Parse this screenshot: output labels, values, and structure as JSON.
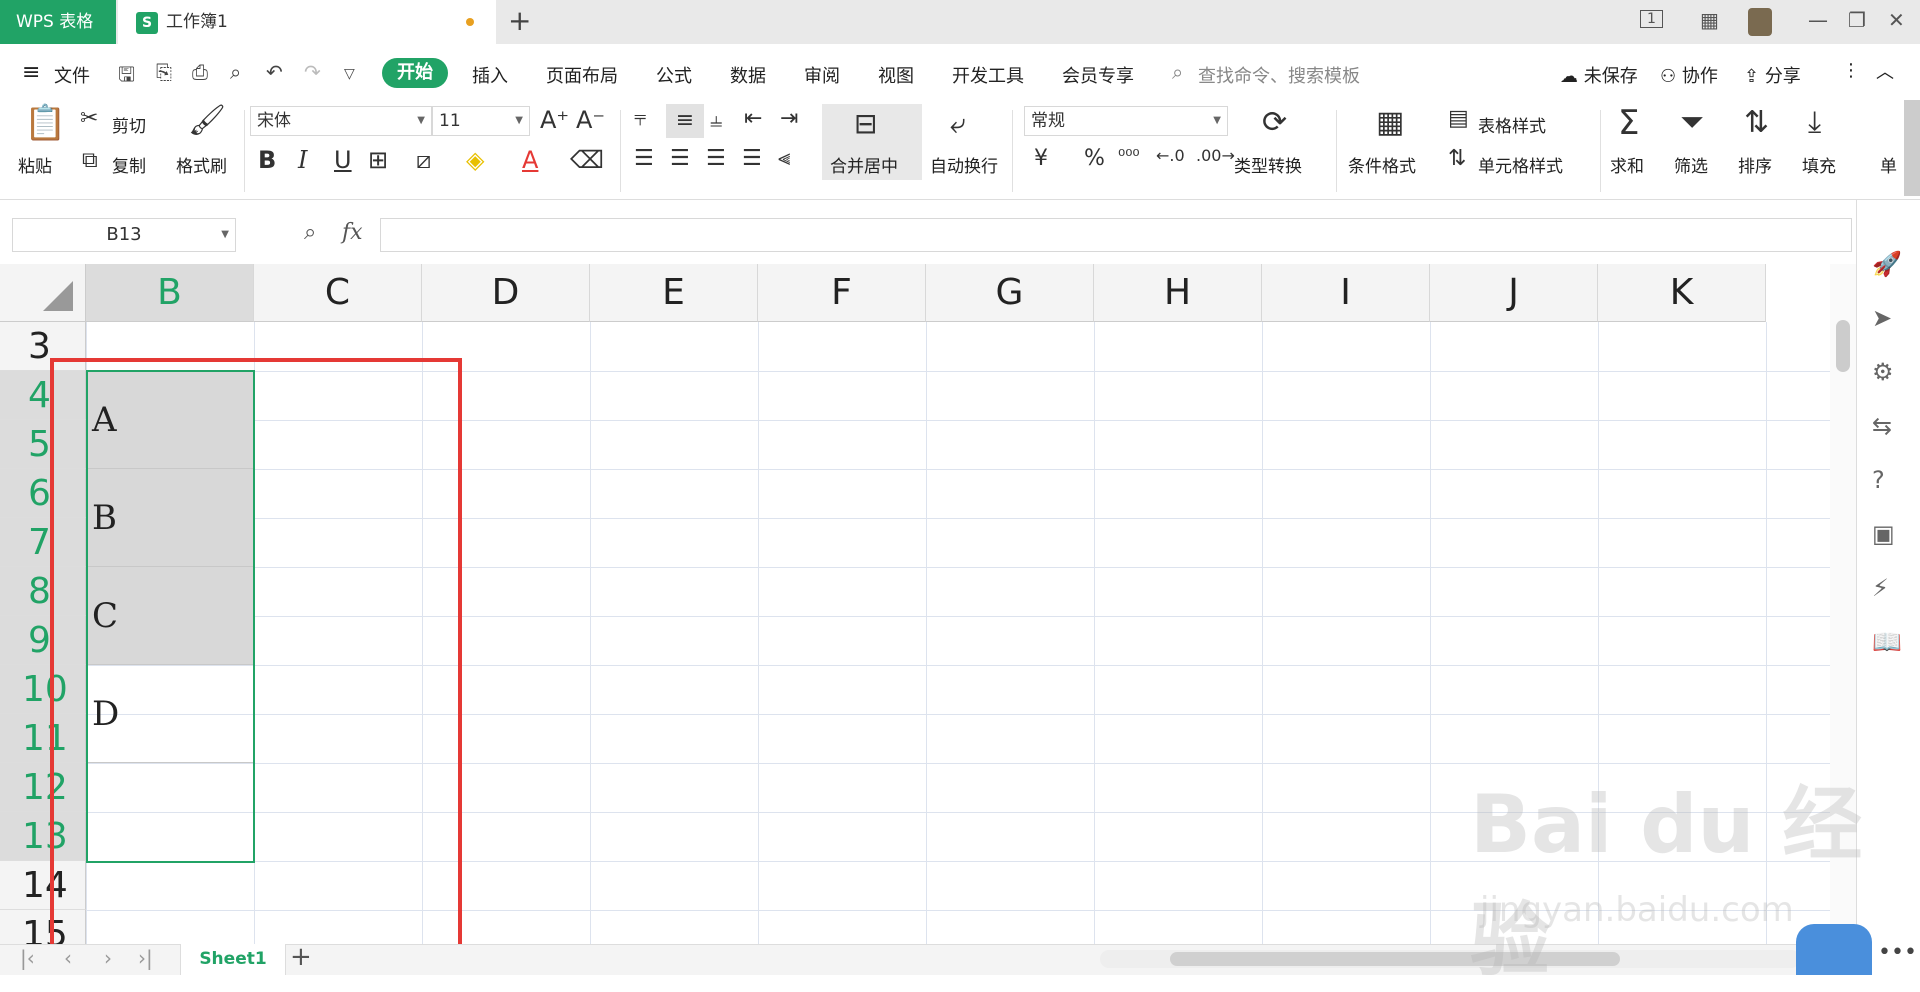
{
  "title_bar": {
    "app_tab": "WPS 表格",
    "doc_tab": "工作簿1",
    "doc_tab_icon": "S",
    "new_tab": "+",
    "controls": [
      "1",
      "▦",
      "—",
      "❐",
      "✕"
    ]
  },
  "menu": {
    "file": "文件",
    "items": [
      "开始",
      "插入",
      "页面布局",
      "公式",
      "数据",
      "审阅",
      "视图",
      "开发工具",
      "会员专享"
    ],
    "search_placeholder": "查找命令、搜索模板",
    "unsaved": "未保存",
    "collaborate": "协作",
    "share": "分享"
  },
  "toolbar": {
    "paste": "粘贴",
    "cut": "剪切",
    "copy": "复制",
    "format_painter": "格式刷",
    "font_name": "宋体",
    "font_size": "11",
    "bold": "B",
    "italic": "I",
    "underline": "U",
    "merge_center": "合并居中",
    "wrap_text": "自动换行",
    "number_format": "常规",
    "currency": "¥",
    "percent": "%",
    "type_convert": "类型转换",
    "cond_format": "条件格式",
    "table_style": "表格样式",
    "cell_style": "单元格样式",
    "sum": "求和",
    "filter": "筛选",
    "sort": "排序",
    "fill": "填充",
    "single": "单"
  },
  "formula_bar": {
    "name_box": "B13",
    "fx": "fx",
    "formula": ""
  },
  "grid": {
    "columns": [
      "B",
      "C",
      "D",
      "E",
      "F",
      "G",
      "H",
      "I",
      "J",
      "K"
    ],
    "selected_column": "B",
    "rows": [
      "3",
      "4",
      "5",
      "6",
      "7",
      "8",
      "9",
      "10",
      "11",
      "12",
      "13",
      "14",
      "15"
    ],
    "selected_rows": [
      "4",
      "5",
      "6",
      "7",
      "8",
      "9",
      "10",
      "11",
      "12",
      "13"
    ],
    "merged_cells": [
      {
        "value": "A",
        "shaded": true
      },
      {
        "value": "B",
        "shaded": true
      },
      {
        "value": "C",
        "shaded": true
      },
      {
        "value": "D",
        "shaded": false
      }
    ]
  },
  "sheets": {
    "active": "Sheet1",
    "add": "+"
  },
  "watermark": {
    "brand": "Bai du 经验",
    "url": "jingyan.baidu.com"
  },
  "colors": {
    "accent": "#21a366",
    "annotation": "#e53935"
  }
}
